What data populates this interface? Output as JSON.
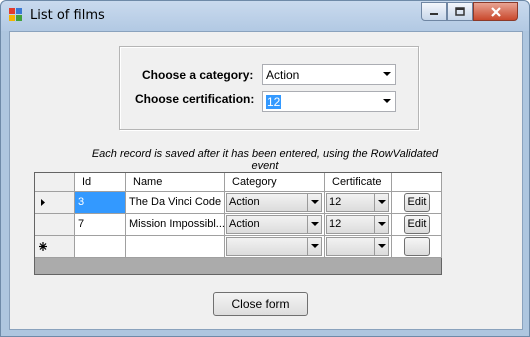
{
  "window": {
    "title": "List of films",
    "controls": {
      "minimize_icon": "minimize-icon",
      "maximize_icon": "maximize-icon",
      "close_icon": "close-icon"
    }
  },
  "filters": {
    "category_label": "Choose a category:",
    "category_value": "Action",
    "certification_label": "Choose certification:",
    "certification_value": "12"
  },
  "note": "Each record is saved after it has been entered, using the RowValidated event",
  "grid": {
    "columns": [
      "Id",
      "Name",
      "Category",
      "Certificate",
      ""
    ],
    "rows": [
      {
        "marker": "current-row-arrow",
        "id": "3",
        "name": "The Da Vinci Code",
        "category": "Action",
        "certificate": "12",
        "button": "Edit"
      },
      {
        "marker": "",
        "id": "7",
        "name": "Mission Impossibl...",
        "category": "Action",
        "certificate": "12",
        "button": "Edit"
      },
      {
        "marker": "new-row-asterisk",
        "id": "",
        "name": "",
        "category": "",
        "certificate": "",
        "button": ""
      }
    ]
  },
  "close_button": "Close form"
}
